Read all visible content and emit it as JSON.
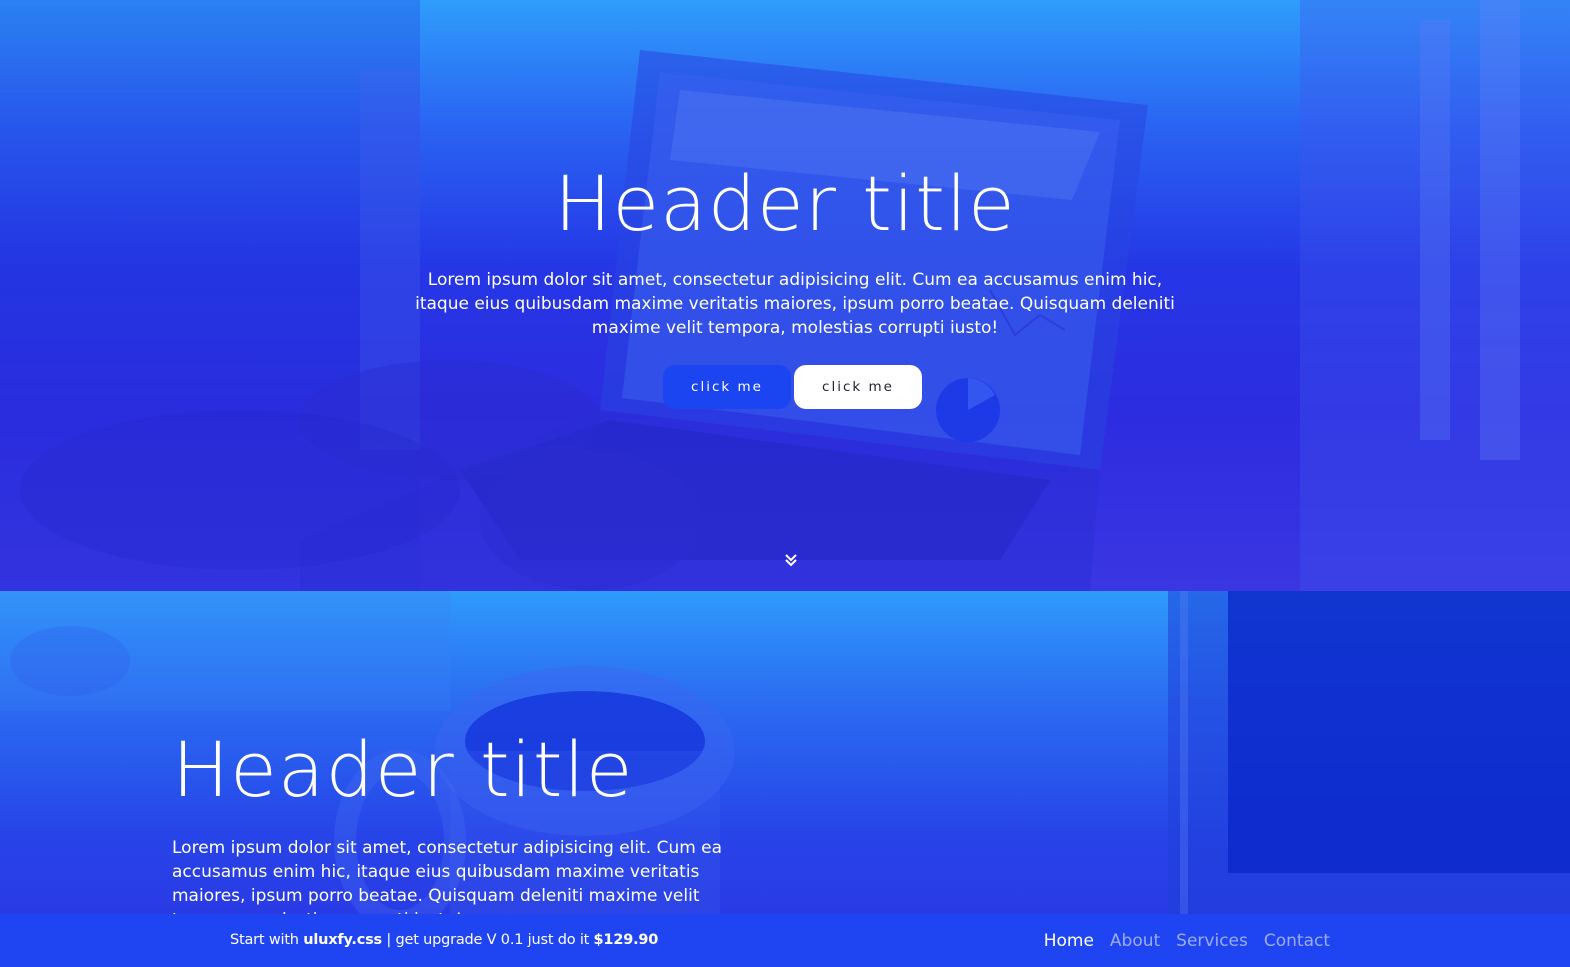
{
  "colors": {
    "accent": "#1a45f0",
    "footer_bg": "#1f45f3",
    "hero_gradient_top": "#2f9dfb",
    "hero_gradient_bottom": "#2d2ce0"
  },
  "hero1": {
    "title": "Header title",
    "text": "Lorem ipsum dolor sit amet, consectetur adipisicing elit. Cum ea accusamus enim hic, itaque eius quibusdam maxime veritatis maiores, ipsum porro beatae. Quisquam deleniti maxime velit tempora, molestias corrupti iusto!",
    "button_primary": "click me",
    "button_secondary": "click me",
    "scroll_icon": "double-chevron-down-icon"
  },
  "hero2": {
    "title": "Header title",
    "text": "Lorem ipsum dolor sit amet, consectetur adipisicing elit. Cum ea accusamus enim hic, itaque eius quibusdam maxime veritatis maiores, ipsum porro beatae. Quisquam deleniti maxime velit tempora, molestias corrupti iusto!"
  },
  "footer": {
    "promo_prefix": "Start with ",
    "promo_brand": "uluxfy.css",
    "promo_middle": " | get upgrade V 0.1 just do it ",
    "promo_price": "$129.90",
    "nav": [
      {
        "label": "Home",
        "active": true
      },
      {
        "label": "About",
        "active": false
      },
      {
        "label": "Services",
        "active": false
      },
      {
        "label": "Contact",
        "active": false
      }
    ]
  }
}
